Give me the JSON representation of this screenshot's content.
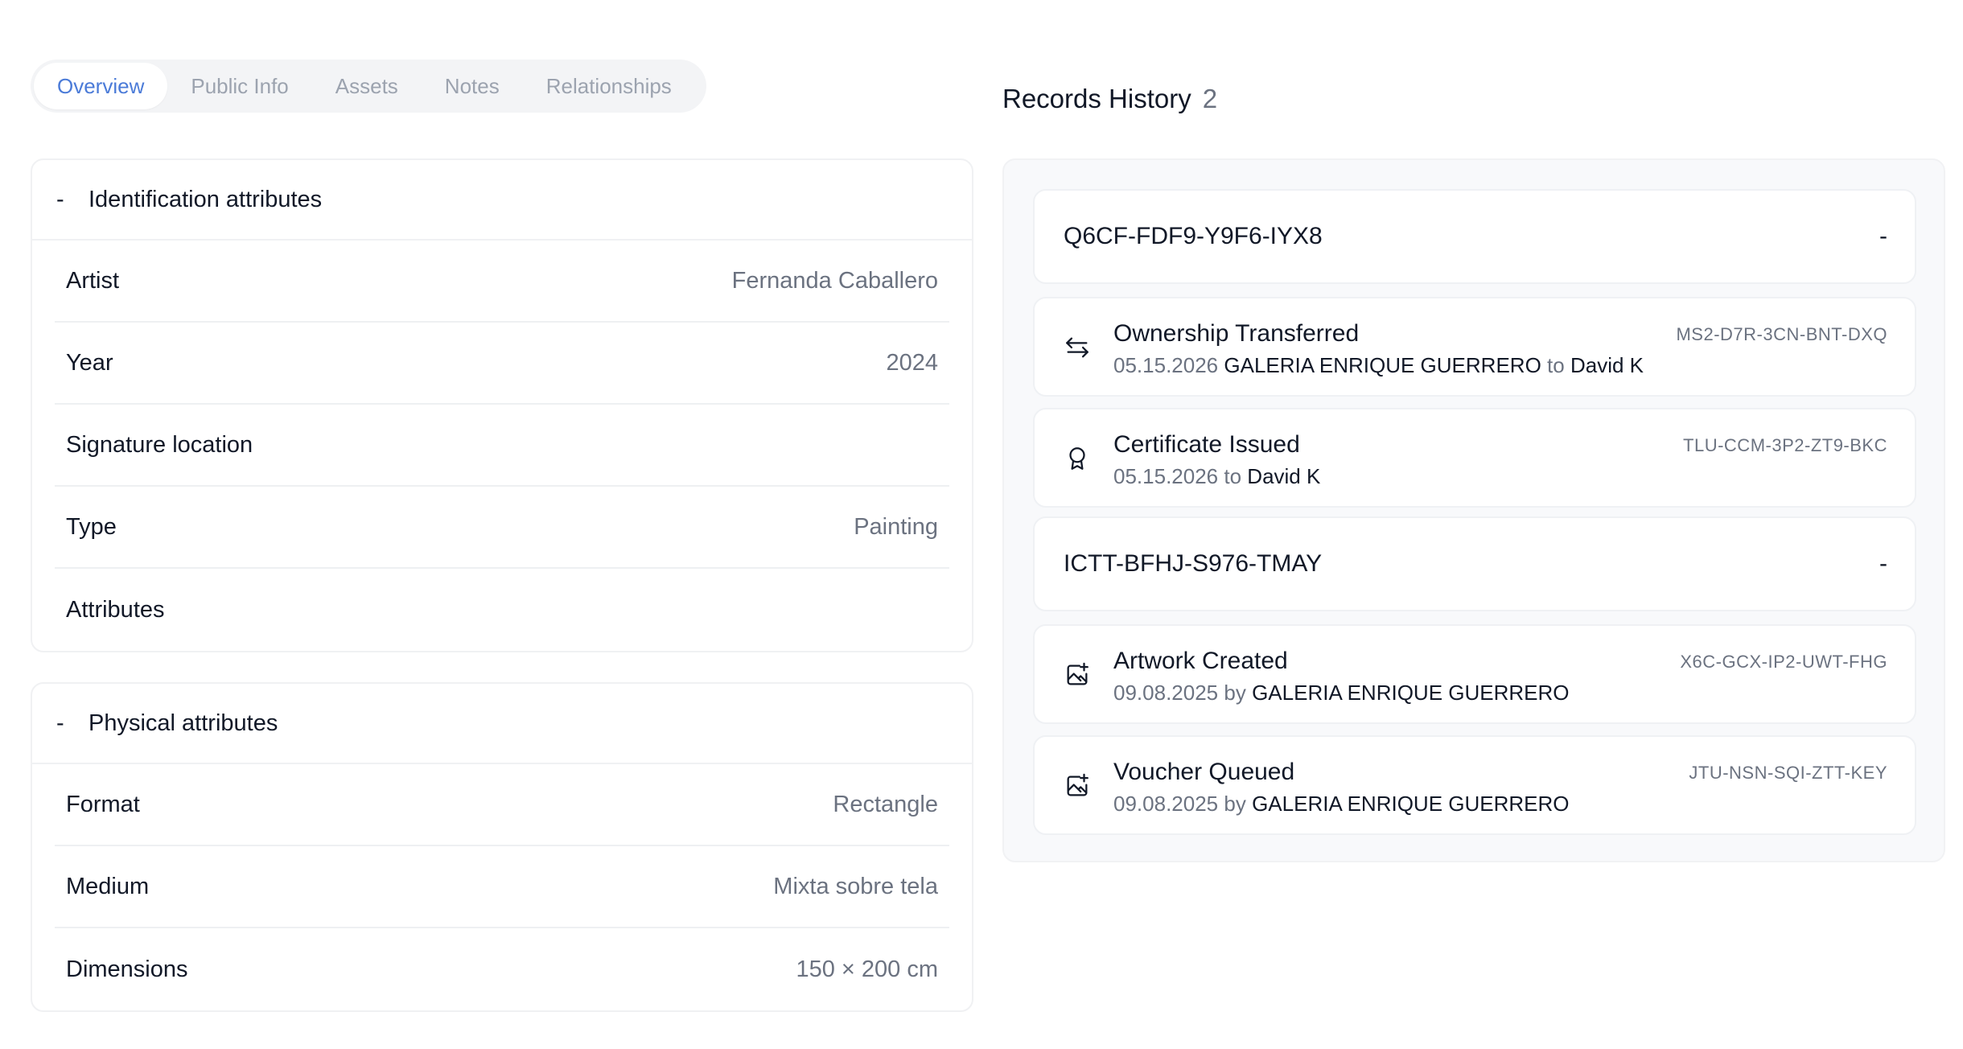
{
  "tabs": [
    {
      "label": "Overview",
      "active": true
    },
    {
      "label": "Public Info"
    },
    {
      "label": "Assets"
    },
    {
      "label": "Notes"
    },
    {
      "label": "Relationships"
    }
  ],
  "identification": {
    "collapse_symbol": "-",
    "title": "Identification attributes",
    "rows": [
      {
        "label": "Artist",
        "value": "Fernanda Caballero"
      },
      {
        "label": "Year",
        "value": "2024"
      },
      {
        "label": "Signature location",
        "value": ""
      },
      {
        "label": "Type",
        "value": "Painting"
      },
      {
        "label": "Attributes",
        "value": ""
      }
    ]
  },
  "physical": {
    "collapse_symbol": "-",
    "title": "Physical attributes",
    "rows": [
      {
        "label": "Format",
        "value": "Rectangle"
      },
      {
        "label": "Medium",
        "value": "Mixta sobre tela"
      },
      {
        "label": "Dimensions",
        "value": "150 × 200 cm"
      }
    ]
  },
  "records_history": {
    "title": "Records History",
    "count": "2",
    "groups": [
      {
        "id": "Q6CF-FDF9-Y9F6-IYX8",
        "toggle": "-",
        "events": [
          {
            "title": "Ownership Transferred",
            "code": "MS2-D7R-3CN-BNT-DXQ",
            "date": "05.15.2026",
            "party1": "GALERIA ENRIQUE GUERRERO",
            "connector": "to",
            "party2": "David K",
            "icon": "arrows-exchange-icon"
          },
          {
            "title": "Certificate Issued",
            "code": "TLU-CCM-3P2-ZT9-BKC",
            "date": "05.15.2026",
            "connector": "to",
            "party2": "David K",
            "icon": "award-icon"
          }
        ]
      },
      {
        "id": "ICTT-BFHJ-S976-TMAY",
        "toggle": "-",
        "events": [
          {
            "title": "Artwork Created",
            "code": "X6C-GCX-IP2-UWT-FHG",
            "date": "09.08.2025",
            "connector": "by",
            "party2": "GALERIA ENRIQUE GUERRERO",
            "icon": "image-plus-icon"
          },
          {
            "title": "Voucher Queued",
            "code": "JTU-NSN-SQI-ZTT-KEY",
            "date": "09.08.2025",
            "connector": "by",
            "party2": "GALERIA ENRIQUE GUERRERO",
            "icon": "image-plus-icon"
          }
        ]
      }
    ]
  },
  "colors": {
    "accent": "#4b7bd8",
    "muted": "#6b7280",
    "panel": "#f8f9fb"
  }
}
